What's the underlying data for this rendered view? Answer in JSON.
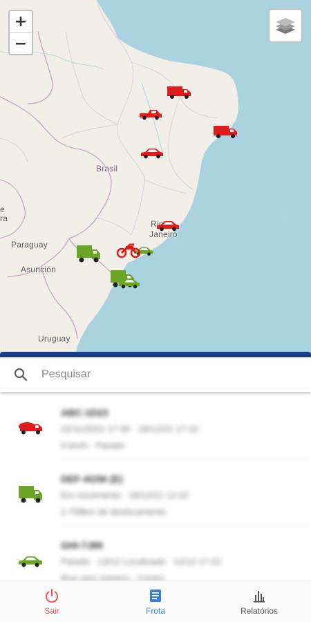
{
  "map": {
    "zoom_in": "+",
    "zoom_out": "−",
    "labels": {
      "brasil": "Brasil",
      "paraguay": "Paraguay",
      "asuncion": "Asunción",
      "uruguay": "Uruguay",
      "rio_line1": "Rio",
      "rio_line2": "Janeiro",
      "edge1": "e",
      "edge2": "ra"
    },
    "colors": {
      "water": "#aad3df",
      "land": "#f2efe9",
      "border": "#c9a3c9",
      "red_vehicle": "#e01b1b",
      "green_vehicle": "#6aa524"
    }
  },
  "search": {
    "placeholder": "Pesquisar"
  },
  "vehicles": [
    {
      "icon": "concrete-mixer-truck-icon",
      "color": "red",
      "plate": "ABC-1D23",
      "line2": "22/11/2021 17:30 · 18/12/21 17:10",
      "line3": "0 km/h · Parado"
    },
    {
      "icon": "box-truck-icon",
      "color": "green",
      "plate": "DEF-4G56 (E)",
      "line2": "Em movimento · 18/12/21 12:42",
      "line3": "2.708km de deslocamento"
    },
    {
      "icon": "car-icon",
      "color": "green",
      "plate": "GHI-7J89",
      "line2": "Parado · 13/12 Localizado · 12/12 17:22",
      "line3": "Rua sem número · Centro"
    }
  ],
  "nav": [
    {
      "label": "Sair",
      "icon": "power-icon",
      "color": "#f2555a"
    },
    {
      "label": "Frota",
      "icon": "document-icon",
      "color": "#3a7fe0"
    },
    {
      "label": "Relatórios",
      "icon": "bar-chart-icon",
      "color": "#555555"
    }
  ]
}
